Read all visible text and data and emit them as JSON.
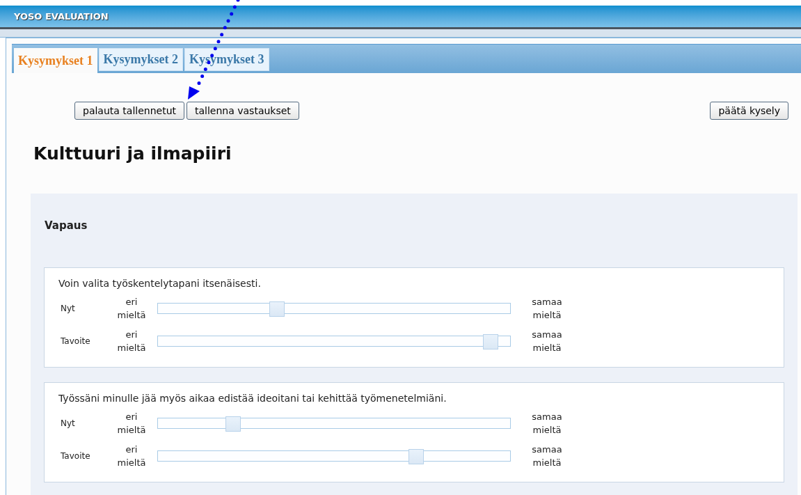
{
  "window": {
    "title": "YOSO EVALUATION"
  },
  "tabs": [
    {
      "label": "Kysymykset 1",
      "selected": true
    },
    {
      "label": "Kysymykset 2",
      "selected": false
    },
    {
      "label": "Kysymykset 3",
      "selected": false
    }
  ],
  "buttons_left": [
    "palauta tallennetut",
    "tallenna vastaukset"
  ],
  "button_right": "päätä kysely",
  "heading": "Kulttuuri ja ilmapiiri",
  "section": {
    "title": "Vapaus",
    "questions": [
      {
        "text": "Voin valita työskentelytapani itsenäisesti.",
        "rows": [
          {
            "label": "Nyt",
            "min_label": "eri mieltä",
            "max_label": "samaa mieltä",
            "level": 0.33
          },
          {
            "label": "Tavoite",
            "min_label": "eri mieltä",
            "max_label": "samaa mieltä",
            "level": 0.96
          }
        ]
      },
      {
        "text": "Työssäni minulle jää myös aikaa edistää ideoitani tai kehittää työmenetelmiäni.",
        "rows": [
          {
            "label": "Nyt",
            "min_label": "eri mieltä",
            "max_label": "samaa mieltä",
            "level": 0.2
          },
          {
            "label": "Tavoite",
            "min_label": "eri mieltä",
            "max_label": "samaa mieltä",
            "level": 0.74
          }
        ]
      }
    ]
  }
}
